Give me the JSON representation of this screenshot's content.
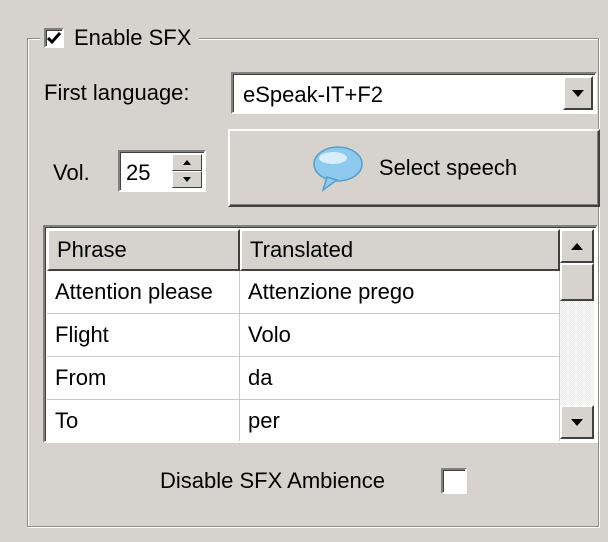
{
  "sfx": {
    "enable_label": "Enable SFX",
    "enabled": true
  },
  "language": {
    "label": "First language:",
    "value": "eSpeak-IT+F2"
  },
  "volume": {
    "label": "Vol.",
    "value": "25"
  },
  "select_speech_button": {
    "label": "Select speech",
    "icon": "speech-bubble-icon"
  },
  "phrase_table": {
    "columns": [
      "Phrase",
      "Translated"
    ],
    "rows": [
      [
        "Attention please",
        "Attenzione prego"
      ],
      [
        "Flight",
        "Volo"
      ],
      [
        "From",
        "da"
      ],
      [
        "To",
        "per"
      ]
    ]
  },
  "ambience": {
    "label": "Disable SFX Ambience",
    "checked": false
  },
  "colors": {
    "window_bg": "#d6d3ce",
    "bubble": "#8ec9ee"
  }
}
